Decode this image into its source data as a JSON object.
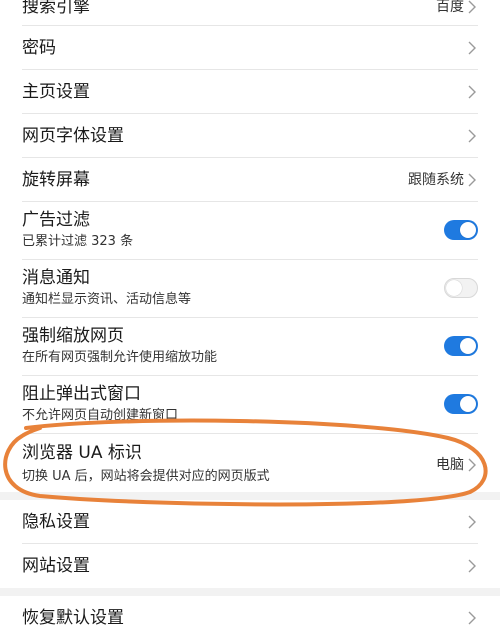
{
  "settings": {
    "search_engine": {
      "label": "搜索引擎",
      "value": "百度"
    },
    "password": {
      "label": "密码"
    },
    "homepage": {
      "label": "主页设置"
    },
    "font": {
      "label": "网页字体设置"
    },
    "rotate": {
      "label": "旋转屏幕",
      "value": "跟随系统"
    },
    "ad_filter": {
      "label": "广告过滤",
      "sub": "已累计过滤 323 条",
      "enabled": true
    },
    "notification": {
      "label": "消息通知",
      "sub": "通知栏显示资讯、活动信息等",
      "enabled": false
    },
    "force_zoom": {
      "label": "强制缩放网页",
      "sub": "在所有网页强制允许使用缩放功能",
      "enabled": true
    },
    "block_popup": {
      "label": "阻止弹出式窗口",
      "sub": "不允许网页自动创建新窗口",
      "enabled": true
    },
    "ua": {
      "label": "浏览器 UA 标识",
      "sub": "切换 UA 后，网站将会提供对应的网页版式",
      "value": "电脑"
    },
    "privacy": {
      "label": "隐私设置"
    },
    "site": {
      "label": "网站设置"
    },
    "reset": {
      "label": "恢复默认设置"
    }
  },
  "colors": {
    "toggle_on": "#1f7ae0",
    "highlight_ring": "#e8823a"
  },
  "icons": {
    "chevron": "chevron-right-icon"
  }
}
